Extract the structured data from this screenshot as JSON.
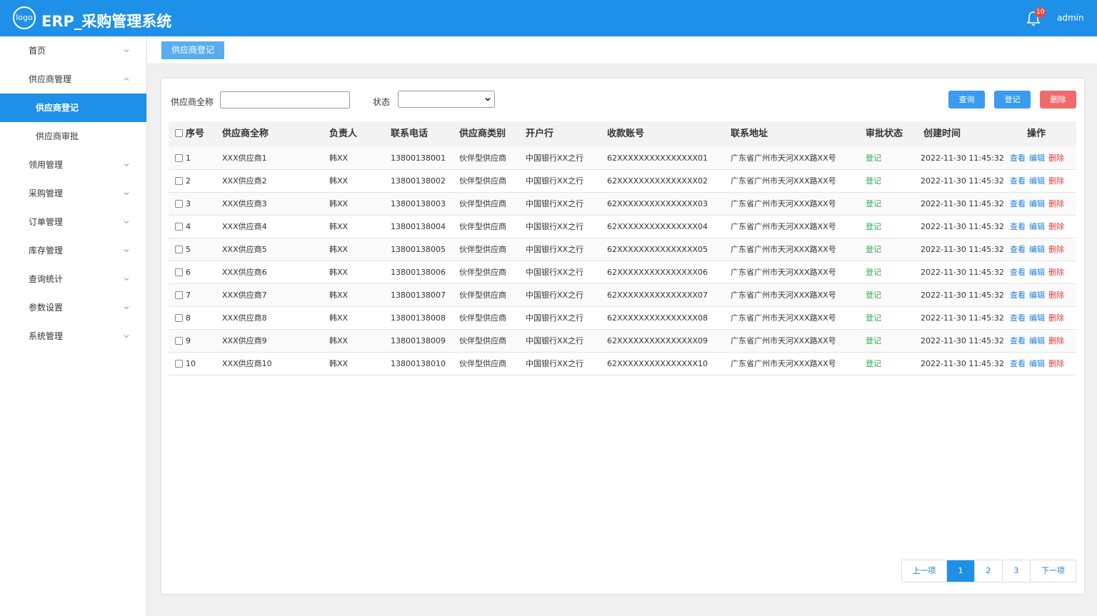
{
  "header": {
    "logo_text": "logo",
    "title": "ERP_采购管理系统",
    "notification_count": "10",
    "user": "admin"
  },
  "sidebar": {
    "items": [
      {
        "label": "首页",
        "expanded": false
      },
      {
        "label": "供应商管理",
        "expanded": true
      },
      {
        "label": "供应商登记",
        "sub": true,
        "active": true
      },
      {
        "label": "供应商审批",
        "sub": true
      },
      {
        "label": "领用管理",
        "expanded": false
      },
      {
        "label": "采购管理",
        "expanded": false
      },
      {
        "label": "订单管理",
        "expanded": false
      },
      {
        "label": "库存管理",
        "expanded": false
      },
      {
        "label": "查询统计",
        "expanded": false
      },
      {
        "label": "参数设置",
        "expanded": false
      },
      {
        "label": "系统管理",
        "expanded": false
      }
    ]
  },
  "tab": {
    "label": "供应商登记"
  },
  "filters": {
    "name_label": "供应商全称",
    "name_value": "",
    "status_label": "状态",
    "status_value": ""
  },
  "actions": {
    "query": "查询",
    "register": "登记",
    "delete": "删除"
  },
  "table": {
    "headers": [
      "序号",
      "供应商全称",
      "负责人",
      "联系电话",
      "供应商类别",
      "开户行",
      "收款账号",
      "联系地址",
      "审批状态",
      "创建时间",
      "操作"
    ],
    "op_labels": {
      "view": "查看",
      "edit": "编辑",
      "delete": "删除"
    },
    "rows": [
      {
        "no": "1",
        "name": "XXX供应商1",
        "owner": "韩XX",
        "phone": "13800138001",
        "type": "伙伴型供应商",
        "bank": "中国银行XX之行",
        "account": "62XXXXXXXXXXXXXXX01",
        "address": "广东省广州市天河XXX路XX号",
        "status": "登记",
        "created": "2022-11-30 11:45:32"
      },
      {
        "no": "2",
        "name": "XXX供应商2",
        "owner": "韩XX",
        "phone": "13800138002",
        "type": "伙伴型供应商",
        "bank": "中国银行XX之行",
        "account": "62XXXXXXXXXXXXXXX02",
        "address": "广东省广州市天河XXX路XX号",
        "status": "登记",
        "created": "2022-11-30 11:45:32"
      },
      {
        "no": "3",
        "name": "XXX供应商3",
        "owner": "韩XX",
        "phone": "13800138003",
        "type": "伙伴型供应商",
        "bank": "中国银行XX之行",
        "account": "62XXXXXXXXXXXXXXX03",
        "address": "广东省广州市天河XXX路XX号",
        "status": "登记",
        "created": "2022-11-30 11:45:32"
      },
      {
        "no": "4",
        "name": "XXX供应商4",
        "owner": "韩XX",
        "phone": "13800138004",
        "type": "伙伴型供应商",
        "bank": "中国银行XX之行",
        "account": "62XXXXXXXXXXXXXXX04",
        "address": "广东省广州市天河XXX路XX号",
        "status": "登记",
        "created": "2022-11-30 11:45:32"
      },
      {
        "no": "5",
        "name": "XXX供应商5",
        "owner": "韩XX",
        "phone": "13800138005",
        "type": "伙伴型供应商",
        "bank": "中国银行XX之行",
        "account": "62XXXXXXXXXXXXXXX05",
        "address": "广东省广州市天河XXX路XX号",
        "status": "登记",
        "created": "2022-11-30 11:45:32"
      },
      {
        "no": "6",
        "name": "XXX供应商6",
        "owner": "韩XX",
        "phone": "13800138006",
        "type": "伙伴型供应商",
        "bank": "中国银行XX之行",
        "account": "62XXXXXXXXXXXXXXX06",
        "address": "广东省广州市天河XXX路XX号",
        "status": "登记",
        "created": "2022-11-30 11:45:32"
      },
      {
        "no": "7",
        "name": "XXX供应商7",
        "owner": "韩XX",
        "phone": "13800138007",
        "type": "伙伴型供应商",
        "bank": "中国银行XX之行",
        "account": "62XXXXXXXXXXXXXXX07",
        "address": "广东省广州市天河XXX路XX号",
        "status": "登记",
        "created": "2022-11-30 11:45:32"
      },
      {
        "no": "8",
        "name": "XXX供应商8",
        "owner": "韩XX",
        "phone": "13800138008",
        "type": "伙伴型供应商",
        "bank": "中国银行XX之行",
        "account": "62XXXXXXXXXXXXXXX08",
        "address": "广东省广州市天河XXX路XX号",
        "status": "登记",
        "created": "2022-11-30 11:45:32"
      },
      {
        "no": "9",
        "name": "XXX供应商9",
        "owner": "韩XX",
        "phone": "13800138009",
        "type": "伙伴型供应商",
        "bank": "中国银行XX之行",
        "account": "62XXXXXXXXXXXXXXX09",
        "address": "广东省广州市天河XXX路XX号",
        "status": "登记",
        "created": "2022-11-30 11:45:32"
      },
      {
        "no": "10",
        "name": "XXX供应商10",
        "owner": "韩XX",
        "phone": "13800138010",
        "type": "伙伴型供应商",
        "bank": "中国银行XX之行",
        "account": "62XXXXXXXXXXXXXXX10",
        "address": "广东省广州市天河XXX路XX号",
        "status": "登记",
        "created": "2022-11-30 11:45:32"
      }
    ]
  },
  "pagination": {
    "prev": "上一项",
    "pages": [
      "1",
      "2",
      "3"
    ],
    "current": "1",
    "next": "下一项"
  },
  "colors": {
    "primary": "#1e90e8",
    "danger": "#ef6b6b",
    "status_green": "#2aa84a"
  }
}
